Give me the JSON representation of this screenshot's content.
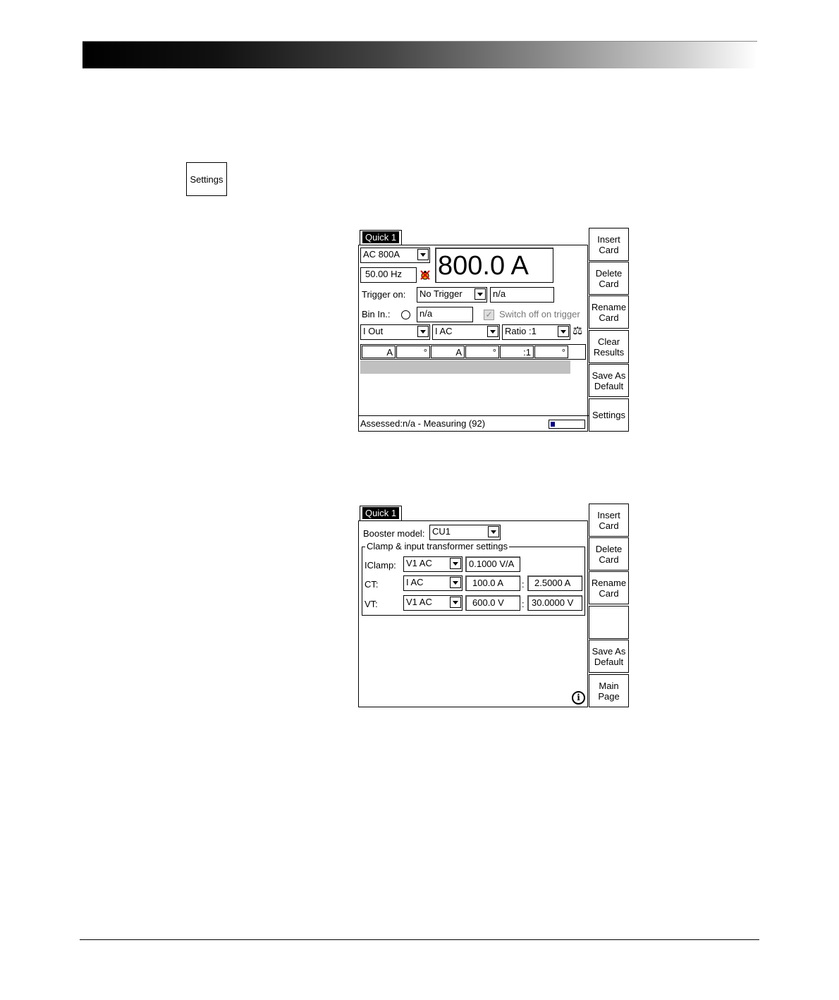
{
  "settings_key": {
    "label": "Settings"
  },
  "screen1": {
    "tab": "Quick 1",
    "range_select": "AC 800A",
    "frequency": "50.00 Hz",
    "big_value": "800.0 A",
    "trigger_label": "Trigger on:",
    "trigger_select": "No Trigger",
    "trigger_value": "n/a",
    "binin_label": "Bin In.:",
    "binin_value": "n/a",
    "switch_off_label": "Switch off on trigger",
    "measure_select1": "I Out",
    "measure_select2": "I AC",
    "measure_select3": "Ratio :1",
    "columns": [
      "A",
      "°",
      "A",
      "°",
      ":1",
      "°"
    ],
    "status": "Assessed:n/a - Measuring (92)",
    "progress_fraction": 0.12,
    "side_keys": [
      "Insert\nCard",
      "Delete\nCard",
      "Rename\nCard",
      "Clear\nResults",
      "Save As\nDefault",
      "Settings"
    ]
  },
  "screen2": {
    "tab": "Quick 1",
    "booster_label": "Booster model:",
    "booster_value": "CU1",
    "group_title": "Clamp & input transformer settings",
    "rows": [
      {
        "label": "IClamp:",
        "select": "V1 AC",
        "value1": "0.1000 V/A",
        "sep": "",
        "value2": ""
      },
      {
        "label": "CT:",
        "select": "I AC",
        "value1": "100.0 A",
        "sep": ":",
        "value2": "2.5000 A"
      },
      {
        "label": "VT:",
        "select": "V1 AC",
        "value1": "600.0 V",
        "sep": ":",
        "value2": "30.0000 V"
      }
    ],
    "side_keys": [
      "Insert\nCard",
      "Delete\nCard",
      "Rename\nCard",
      "",
      "Save As\nDefault",
      "Main\nPage"
    ]
  }
}
